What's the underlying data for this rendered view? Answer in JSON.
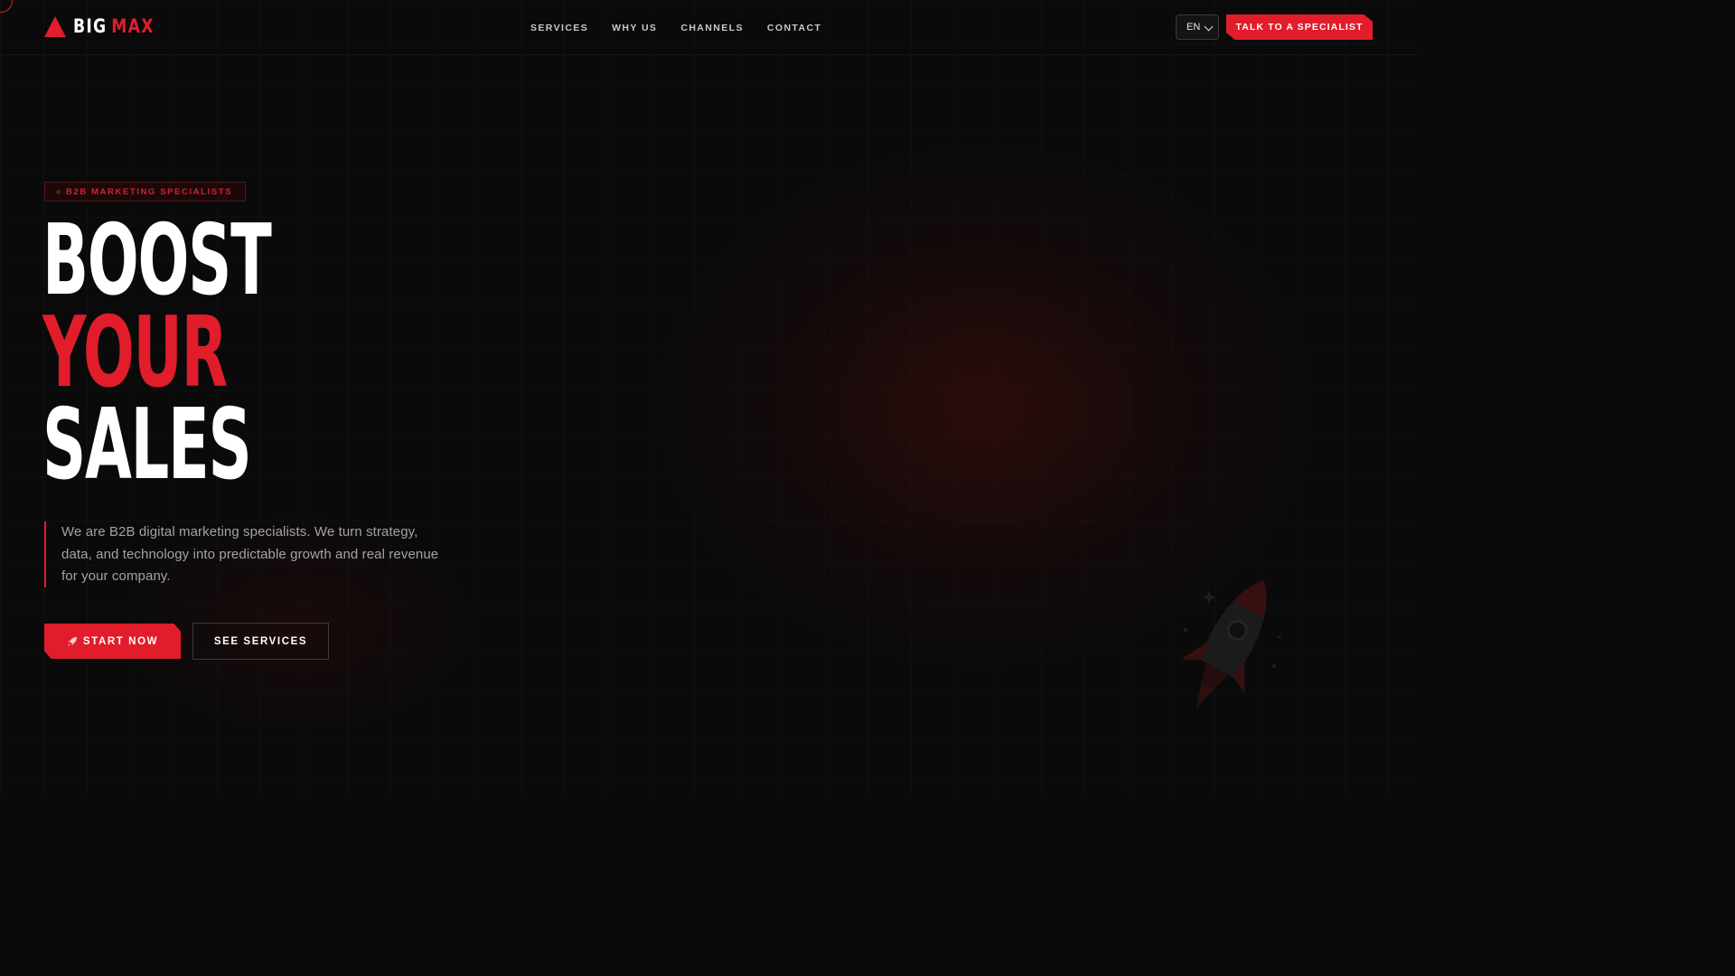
{
  "brand": {
    "name_a": "BIG",
    "name_b": "MAX",
    "accent": "#e11d2b"
  },
  "nav": {
    "items": [
      {
        "label": "SERVICES"
      },
      {
        "label": "WHY US"
      },
      {
        "label": "CHANNELS"
      },
      {
        "label": "CONTACT"
      }
    ]
  },
  "language": {
    "selected": "EN"
  },
  "header_cta": {
    "label": "TALK TO A SPECIALIST"
  },
  "hero": {
    "badge": "B2B MARKETING SPECIALISTS",
    "headline": {
      "line1": "BOOST",
      "line2": "YOUR",
      "line3": "SALES"
    },
    "lead": "We are B2B digital marketing specialists. We turn strategy, data, and technology into predictable growth and real revenue for your company.",
    "primary_cta": {
      "label": "START NOW",
      "icon": "rocket-icon"
    },
    "secondary_cta": {
      "label": "SEE SERVICES"
    }
  },
  "colors": {
    "background": "#0a0a0a",
    "accent": "#e11d2b",
    "muted_text": "#a3a3a3"
  }
}
